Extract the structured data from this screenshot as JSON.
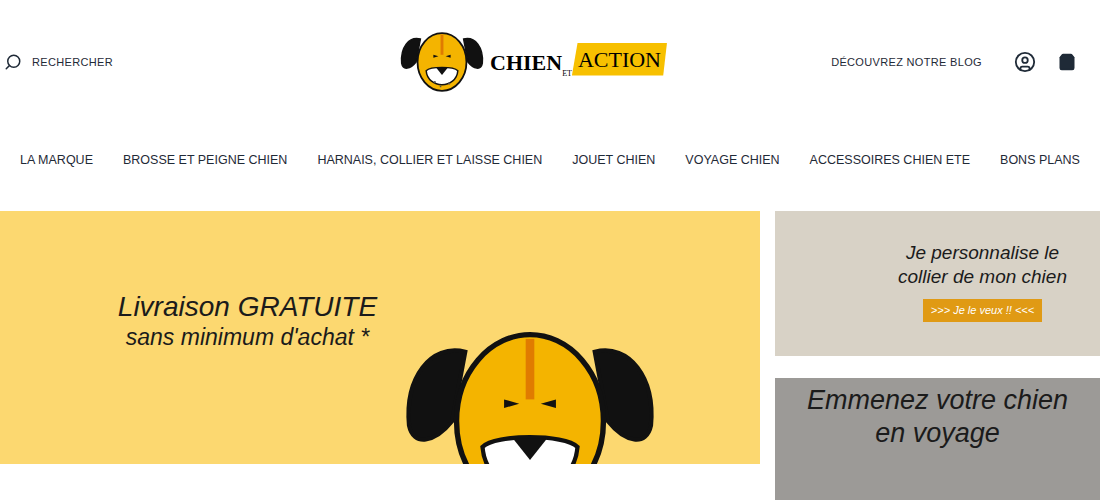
{
  "header": {
    "search": {
      "label": "RECHERCHER"
    },
    "logo": {
      "parts": [
        "CHIEN",
        "ET",
        "ACTION"
      ]
    },
    "blog_link": "DÉCOUVREZ NOTRE BLOG"
  },
  "nav": {
    "items": [
      "LA MARQUE",
      "BROSSE ET PEIGNE CHIEN",
      "HARNAIS, COLLIER ET LAISSE CHIEN",
      "JOUET CHIEN",
      "VOYAGE CHIEN",
      "ACCESSOIRES CHIEN ETE",
      "BONS PLANS"
    ]
  },
  "hero": {
    "lines": [
      "Livraison GRATUITE",
      "sans minimum d'achat *"
    ]
  },
  "promos": [
    {
      "lines": [
        "Je personnalise le",
        "collier de mon chien"
      ],
      "button": ">>> Je le veux !! <<<"
    },
    {
      "lines": [
        "Emmenez votre chien",
        "en voyage"
      ],
      "button": ""
    }
  ]
}
